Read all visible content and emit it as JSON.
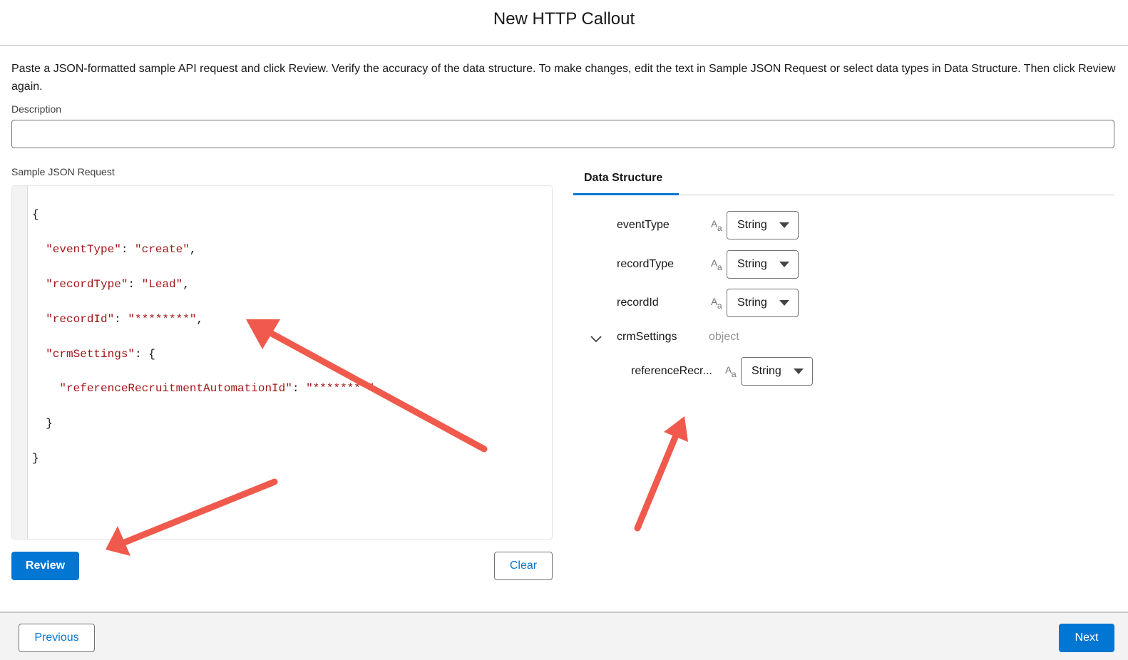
{
  "header": {
    "title": "New HTTP Callout"
  },
  "instructions": "Paste a JSON-formatted sample API request and click Review. Verify the accuracy of the data structure. To make changes, edit the text in Sample JSON Request or select data types in Data Structure. Then click Review again.",
  "description": {
    "label": "Description",
    "value": ""
  },
  "sample_json": {
    "label": "Sample JSON Request",
    "lines": [
      {
        "pre": "{"
      },
      {
        "pre": "  ",
        "key": "\"eventType\"",
        "mid": ": ",
        "val": "\"create\"",
        "post": ","
      },
      {
        "pre": "  ",
        "key": "\"recordType\"",
        "mid": ": ",
        "val": "\"Lead\"",
        "post": ","
      },
      {
        "pre": "  ",
        "key": "\"recordId\"",
        "mid": ": ",
        "val": "\"********\"",
        "post": ","
      },
      {
        "pre": "  ",
        "key": "\"crmSettings\"",
        "mid": ": {"
      },
      {
        "pre": "    ",
        "key": "\"referenceRecruitmentAutomationId\"",
        "mid": ": ",
        "val": "\"********\""
      },
      {
        "pre": "  }"
      },
      {
        "pre": "}"
      }
    ]
  },
  "buttons": {
    "review": "Review",
    "clear": "Clear",
    "previous": "Previous",
    "next": "Next"
  },
  "data_structure": {
    "tab": "Data Structure",
    "fields": [
      {
        "name": "eventType",
        "type": "String"
      },
      {
        "name": "recordType",
        "type": "String"
      },
      {
        "name": "recordId",
        "type": "String"
      },
      {
        "name": "crmSettings",
        "type_label": "object"
      },
      {
        "name": "referenceRecr...",
        "type": "String"
      }
    ],
    "text_icon_glyphs": {
      "upper": "A",
      "lower": "a"
    }
  },
  "colors": {
    "brand": "#0176d3",
    "json_string": "#a31515",
    "annotation_arrow": "#ef5a4c"
  }
}
